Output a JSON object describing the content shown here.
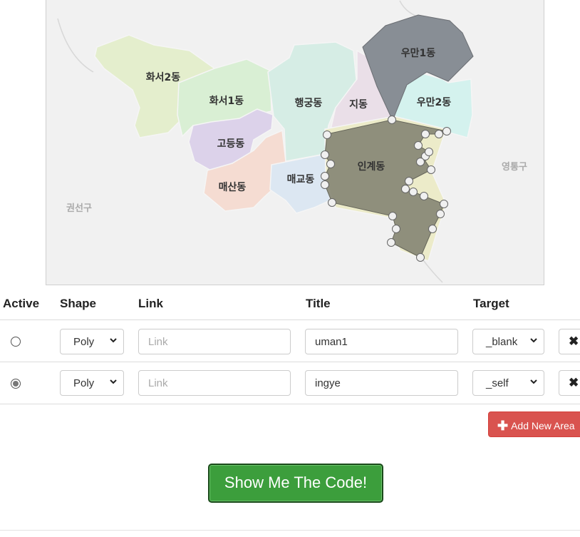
{
  "map": {
    "regions": {
      "hwaseo2": "화서2동",
      "hwaseo1": "화서1동",
      "godeung": "고등동",
      "maesan": "매산동",
      "haenggung": "행궁동",
      "maegyo": "매교동",
      "ji": "지동",
      "uman1": "우만1동",
      "uman2": "우만2동",
      "ingye": "인계동"
    },
    "districts": {
      "gwonseon": "권선구",
      "yeongtong": "영통구"
    }
  },
  "table": {
    "headers": {
      "active": "Active",
      "shape": "Shape",
      "link": "Link",
      "title": "Title",
      "target": "Target"
    },
    "rows": [
      {
        "active": false,
        "shape": "Poly",
        "link_value": "",
        "link_placeholder": "Link",
        "title": "uman1",
        "target": "_blank",
        "delete_icon": "✖"
      },
      {
        "active": true,
        "shape": "Poly",
        "link_value": "",
        "link_placeholder": "Link",
        "title": "ingye",
        "target": "_self",
        "delete_icon": "✖"
      }
    ]
  },
  "buttons": {
    "add_area": "Add New Area",
    "add_icon": "✚",
    "show_code": "Show Me The Code!"
  },
  "colors": {
    "add_button": "#d9534f",
    "show_button": "#3c9e3c",
    "selected_area_fill": "#8a8a78"
  }
}
